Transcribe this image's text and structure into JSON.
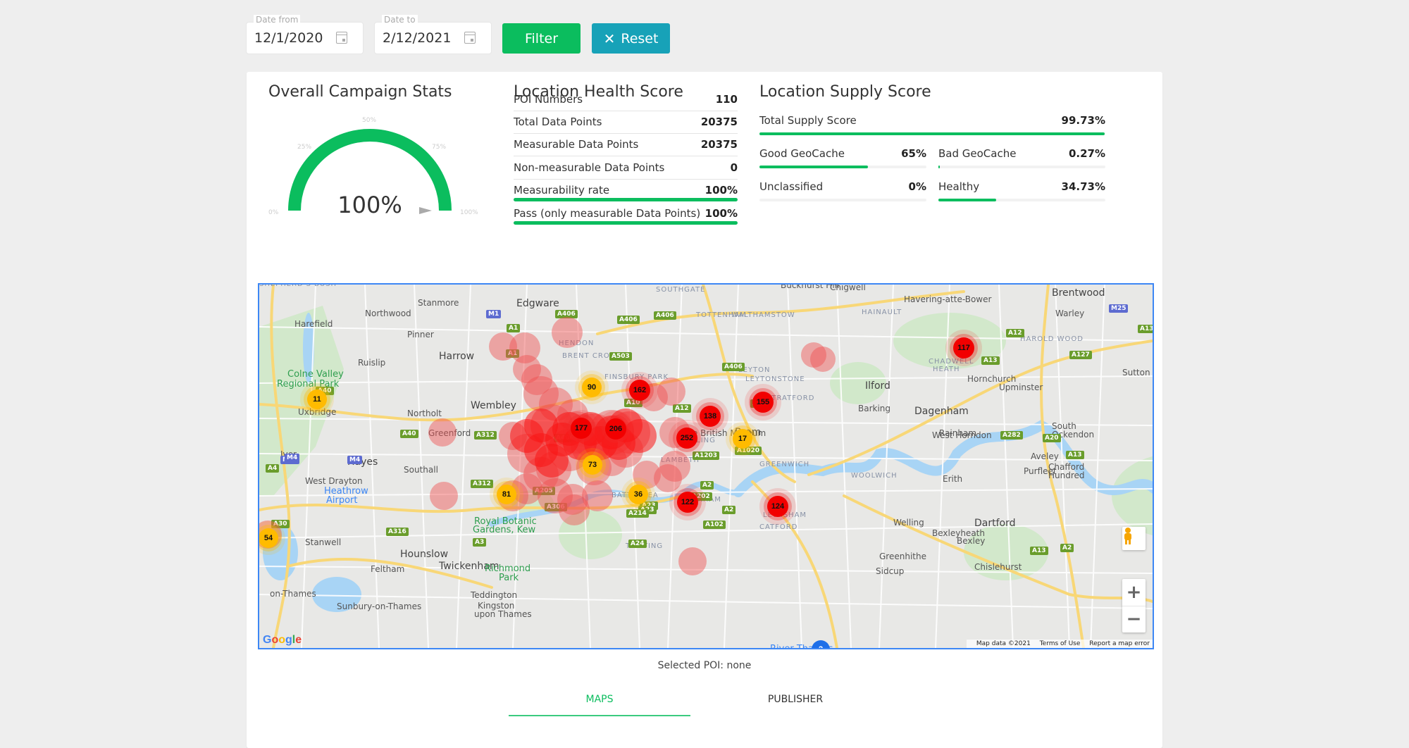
{
  "filters": {
    "date_from": {
      "label": "Date from",
      "value": "12/1/2020",
      "icon": "calendar-icon"
    },
    "date_to": {
      "label": "Date to",
      "value": "2/12/2021",
      "icon": "calendar-icon"
    },
    "filter_label": "Filter",
    "reset_label": "Reset",
    "reset_icon": "close-icon"
  },
  "colors": {
    "accent_green": "#0bbd5e",
    "reset_teal": "#17a2b8",
    "cluster_red": "#f20000",
    "cluster_yellow": "#ffbb00",
    "map_border": "#3d87f5"
  },
  "campaign_stats": {
    "title": "Overall Campaign Stats",
    "gauge_value_label": "100%",
    "gauge_value": 100,
    "gauge_ticks": [
      "0%",
      "25%",
      "50%",
      "75%",
      "100%"
    ]
  },
  "health_score": {
    "title": "Location Health Score",
    "rows": [
      {
        "label": "POI Numbers",
        "value": "110"
      },
      {
        "label": "Total Data Points",
        "value": "20375"
      },
      {
        "label": "Measurable Data Points",
        "value": "20375"
      },
      {
        "label": "Non-measurable Data Points",
        "value": "0"
      },
      {
        "label": "Measurability rate",
        "value": "100%",
        "progress": 100
      },
      {
        "label": "Pass (only measurable Data Points)",
        "value": "100%",
        "progress": 100
      }
    ]
  },
  "supply_score": {
    "title": "Location Supply Score",
    "total": {
      "label": "Total Supply Score",
      "value": "99.73%",
      "progress": 99.73
    },
    "items": [
      {
        "label": "Good GeoCache",
        "value": "65%",
        "progress": 65
      },
      {
        "label": "Bad GeoCache",
        "value": "0.27%",
        "progress": 0.27
      },
      {
        "label": "Unclassified",
        "value": "0%",
        "progress": 0
      },
      {
        "label": "Healthy",
        "value": "34.73%",
        "progress": 34.73
      }
    ]
  },
  "map": {
    "places": [
      {
        "name": "Northwood",
        "cls": ""
      },
      {
        "name": "Harefield",
        "cls": ""
      },
      {
        "name": "Stanmore",
        "cls": ""
      },
      {
        "name": "Edgware",
        "cls": "big"
      },
      {
        "name": "Pinner",
        "cls": ""
      },
      {
        "name": "Harrow",
        "cls": "big"
      },
      {
        "name": "Ruislip",
        "cls": ""
      },
      {
        "name": "Colne Valley",
        "cls": "park"
      },
      {
        "name": "Regional Park",
        "cls": "park"
      },
      {
        "name": "Uxbridge",
        "cls": ""
      },
      {
        "name": "Northolt",
        "cls": ""
      },
      {
        "name": "Wembley",
        "cls": "big"
      },
      {
        "name": "Greenford",
        "cls": ""
      },
      {
        "name": "Hayes",
        "cls": "big"
      },
      {
        "name": "Southall",
        "cls": ""
      },
      {
        "name": "West Drayton",
        "cls": ""
      },
      {
        "name": "Heathrow",
        "cls": "blue"
      },
      {
        "name": "Airport",
        "cls": "blue"
      },
      {
        "name": "Hounslow",
        "cls": "big"
      },
      {
        "name": "Stanwell",
        "cls": ""
      },
      {
        "name": "Feltham",
        "cls": ""
      },
      {
        "name": "Twickenham",
        "cls": "big"
      },
      {
        "name": "Royal Botanic",
        "cls": "park"
      },
      {
        "name": "Gardens, Kew",
        "cls": "park"
      },
      {
        "name": "Richmond",
        "cls": "park"
      },
      {
        "name": "Park",
        "cls": "park"
      },
      {
        "name": "Teddington",
        "cls": ""
      },
      {
        "name": "Sunbury-on-Thames",
        "cls": ""
      },
      {
        "name": "Kingston",
        "cls": ""
      },
      {
        "name": "upon Thames",
        "cls": ""
      },
      {
        "name": "on-Thames",
        "cls": ""
      },
      {
        "name": "Iver",
        "cls": ""
      },
      {
        "name": "SOUTHGATE",
        "cls": "dist"
      },
      {
        "name": "TOTTENHAM",
        "cls": "dist"
      },
      {
        "name": "HENDON",
        "cls": "dist"
      },
      {
        "name": "BRENT CROSS",
        "cls": "dist"
      },
      {
        "name": "WALTHAMSTOW",
        "cls": "dist"
      },
      {
        "name": "FINSBURY PARK",
        "cls": "dist"
      },
      {
        "name": "LEYTON",
        "cls": "dist"
      },
      {
        "name": "LEYTONSTONE",
        "cls": "dist"
      },
      {
        "name": "STRATFORD",
        "cls": "dist"
      },
      {
        "name": "The British Museum",
        "cls": ""
      },
      {
        "name": "LAMBETH",
        "cls": "dist"
      },
      {
        "name": "BATTERSEA",
        "cls": "dist"
      },
      {
        "name": "PECKHAM",
        "cls": "dist"
      },
      {
        "name": "GREENWICH",
        "cls": "dist"
      },
      {
        "name": "LEWISHAM",
        "cls": "dist"
      },
      {
        "name": "CATFORD",
        "cls": "dist"
      },
      {
        "name": "TOOTING",
        "cls": "dist"
      },
      {
        "name": "WOOLWICH",
        "cls": "dist"
      },
      {
        "name": "Buckhurst Hill",
        "cls": ""
      },
      {
        "name": "Chigwell",
        "cls": ""
      },
      {
        "name": "HAINAULT",
        "cls": "dist"
      },
      {
        "name": "Havering-atte-Bower",
        "cls": ""
      },
      {
        "name": "Brentwood",
        "cls": "big"
      },
      {
        "name": "Warley",
        "cls": ""
      },
      {
        "name": "HAROLD WOOD",
        "cls": "dist"
      },
      {
        "name": "CHADWELL",
        "cls": "dist"
      },
      {
        "name": "HEATH",
        "cls": "dist"
      },
      {
        "name": "Hornchurch",
        "cls": ""
      },
      {
        "name": "Upminster",
        "cls": ""
      },
      {
        "name": "Ilford",
        "cls": "big"
      },
      {
        "name": "Barking",
        "cls": ""
      },
      {
        "name": "Dagenham",
        "cls": "big"
      },
      {
        "name": "Rainham",
        "cls": ""
      },
      {
        "name": "South",
        "cls": ""
      },
      {
        "name": "Ockendon",
        "cls": ""
      },
      {
        "name": "Aveley",
        "cls": ""
      },
      {
        "name": "Purfleet",
        "cls": ""
      },
      {
        "name": "Chafford",
        "cls": ""
      },
      {
        "name": "Hundred",
        "cls": ""
      },
      {
        "name": "Erith",
        "cls": ""
      },
      {
        "name": "Welling",
        "cls": ""
      },
      {
        "name": "Bexleyheath",
        "cls": ""
      },
      {
        "name": "Bexley",
        "cls": ""
      },
      {
        "name": "Dartford",
        "cls": "big"
      },
      {
        "name": "Greenhithe",
        "cls": ""
      },
      {
        "name": "Sidcup",
        "cls": ""
      },
      {
        "name": "Chislehurst",
        "cls": ""
      },
      {
        "name": "Sutton at Hone",
        "cls": ""
      },
      {
        "name": "West Horndon",
        "cls": ""
      },
      {
        "name": "River Thames",
        "cls": "blue"
      },
      {
        "name": "Brom",
        "cls": "big"
      },
      {
        "name": "EALING",
        "cls": "dist"
      },
      {
        "name": "SHEPHERD'S BUSH",
        "cls": "dist"
      }
    ],
    "roads": [
      "M1",
      "A1",
      "A406",
      "A406",
      "A406",
      "A1",
      "A503",
      "A10",
      "A12",
      "A12",
      "A12",
      "A13",
      "A13",
      "A1203",
      "A2",
      "A202",
      "A23",
      "A23",
      "A214",
      "A24",
      "A306",
      "A205",
      "A3",
      "A4",
      "A40",
      "A40",
      "M25",
      "M4",
      "M4",
      "A312",
      "A312",
      "A30",
      "A316",
      "A406",
      "A102",
      "A1020",
      "A2",
      "A20",
      "A2",
      "A282",
      "A13",
      "A127",
      "M25",
      "A406",
      "A13"
    ],
    "clusters": [
      {
        "count": "11",
        "level": "yellow"
      },
      {
        "count": "90",
        "level": "yellow"
      },
      {
        "count": "162",
        "level": "red"
      },
      {
        "count": "155",
        "level": "red"
      },
      {
        "count": "138",
        "level": "red"
      },
      {
        "count": "177",
        "level": "red"
      },
      {
        "count": "206",
        "level": "red"
      },
      {
        "count": "252",
        "level": "red"
      },
      {
        "count": "17",
        "level": "yellow"
      },
      {
        "count": "73",
        "level": "yellow"
      },
      {
        "count": "81",
        "level": "yellow"
      },
      {
        "count": "36",
        "level": "yellow"
      },
      {
        "count": "122",
        "level": "red"
      },
      {
        "count": "124",
        "level": "red"
      },
      {
        "count": "117",
        "level": "red"
      },
      {
        "count": "54",
        "level": "yellow"
      },
      {
        "count": "2",
        "level": "blue"
      }
    ],
    "attribution": {
      "data": "Map data ©2021",
      "terms": "Terms of Use",
      "report": "Report a map error"
    },
    "logo": "Google",
    "controls": {
      "pegman": "pegman-icon",
      "zoom_in": "+",
      "zoom_out": "−"
    }
  },
  "selected_poi": "Selected POI: none",
  "tabs": [
    {
      "label": "MAPS",
      "active": true
    },
    {
      "label": "PUBLISHER",
      "active": false
    }
  ]
}
